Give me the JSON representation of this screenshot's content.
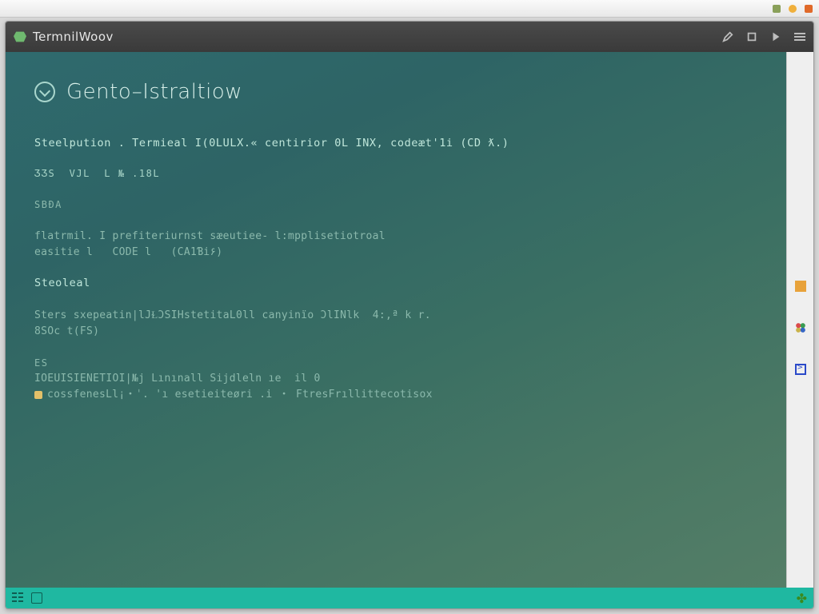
{
  "window": {
    "app_title": "TermnilWoov"
  },
  "terminal": {
    "heading": "Gento–Istraltiow",
    "line1": "Steelpution . Termieal I(0LULX.« centirior 0L INX, codeæt'1i (CD ƛ.)",
    "line2": "ƷƷS  VJL  L № .18l",
    "line3": "SBƉA",
    "line4": "flatrmil. I prefiteriurnst sæeutiee- l:mpplisetiotroal",
    "line5": "easitie l   CODE l   (CA1Ɓi۶)",
    "section": "Steoleal",
    "line6": "Sters sxepeatin|lJⱢƆSIHstetitaL0ll canyinïo ƆlINlk  4:,ª k r.",
    "line7": "8SOc t(FS)",
    "line8": "ES",
    "line9": "IOEUISIENETIOI|№j Lınınall Sijdleln ıe  il 0",
    "line10": "cossfenesLl¡・ˈ. 'ı esetieiteøri .i ・ FtresFrıllittecotisox"
  },
  "icons": {
    "shield": "shield-icon",
    "cluster": "apps-icon",
    "console": "console-icon",
    "orange_sq": "marker-icon"
  }
}
